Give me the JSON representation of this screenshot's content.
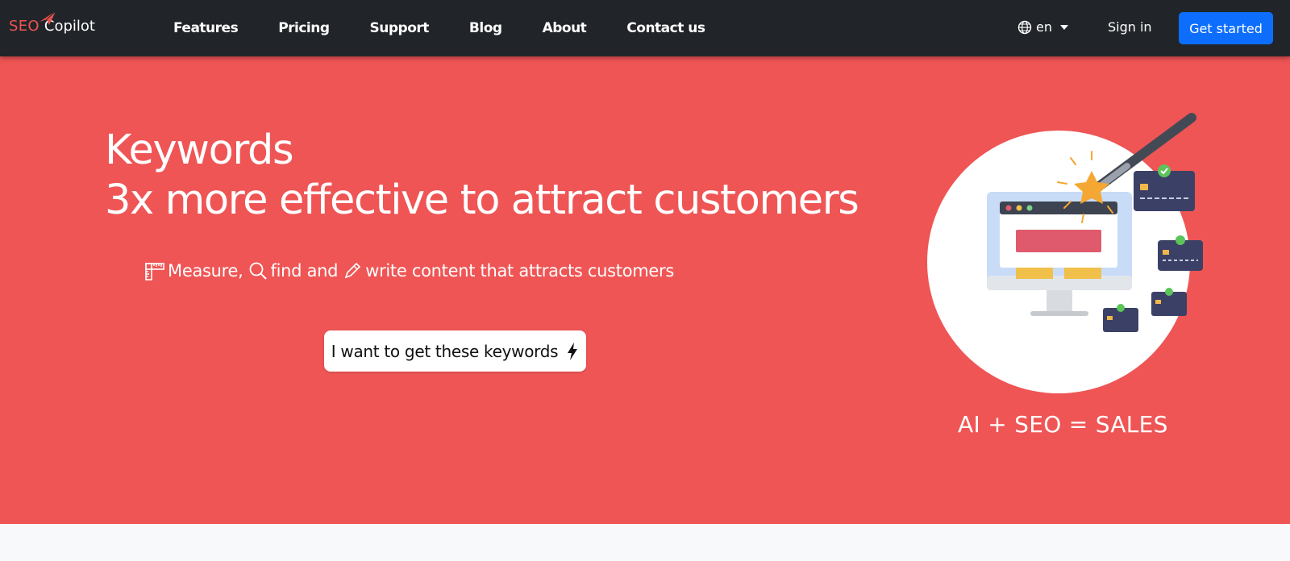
{
  "brand": {
    "part1": "SEO",
    "part2": "Copilot"
  },
  "nav": {
    "links": [
      {
        "label": "Features"
      },
      {
        "label": "Pricing"
      },
      {
        "label": "Support"
      },
      {
        "label": "Blog"
      },
      {
        "label": "About"
      },
      {
        "label": "Contact us"
      }
    ],
    "language": "en",
    "sign_in": "Sign in",
    "get_started": "Get started"
  },
  "hero": {
    "title_line1": "Keywords",
    "title_line2": "3x more effective to attract customers",
    "sub_measure": "Measure,",
    "sub_find": "find and",
    "sub_write": "write content that attracts customers",
    "cta": "I want to get these keywords",
    "tagline": "AI + SEO = SALES"
  },
  "colors": {
    "navbar": "#212529",
    "hero": "#ef5555",
    "primary": "#0d6efd",
    "brand_red": "#ef5350"
  },
  "icons": [
    "paper-plane-icon",
    "globe-icon",
    "caret-down-icon",
    "ruler-icon",
    "search-icon",
    "pencil-icon",
    "lightning-icon"
  ]
}
